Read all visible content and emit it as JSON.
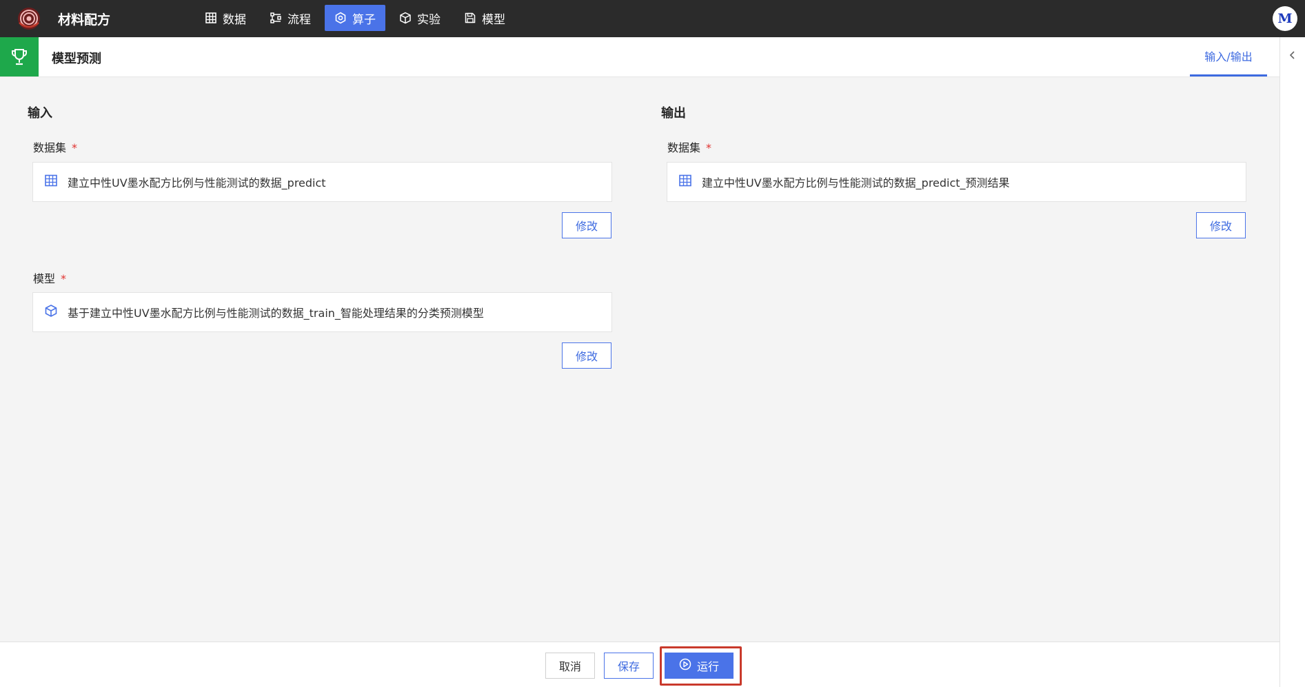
{
  "app": {
    "title": "材料配方",
    "avatar_letter": "M"
  },
  "nav": {
    "items": [
      {
        "label": "数据",
        "icon": "table-grid-icon",
        "active": false
      },
      {
        "label": "流程",
        "icon": "flow-icon",
        "active": false
      },
      {
        "label": "算子",
        "icon": "hexagon-icon",
        "active": true
      },
      {
        "label": "实验",
        "icon": "cube-icon",
        "active": false
      },
      {
        "label": "模型",
        "icon": "floppy-disk-icon",
        "active": false
      }
    ]
  },
  "header": {
    "title": "模型预测",
    "icon": "trophy-icon",
    "tab_label": "输入/输出"
  },
  "input": {
    "section_title": "输入",
    "dataset": {
      "label": "数据集",
      "required": "*",
      "value": "建立中性UV墨水配方比例与性能测试的数据_predict",
      "icon": "table-grid-icon",
      "edit_label": "修改"
    },
    "model": {
      "label": "模型",
      "required": "*",
      "value": "基于建立中性UV墨水配方比例与性能测试的数据_train_智能处理结果的分类预测模型",
      "icon": "cube-icon",
      "edit_label": "修改"
    }
  },
  "output": {
    "section_title": "输出",
    "dataset": {
      "label": "数据集",
      "required": "*",
      "value": "建立中性UV墨水配方比例与性能测试的数据_predict_预测结果",
      "icon": "table-grid-icon",
      "edit_label": "修改"
    }
  },
  "footer": {
    "cancel_label": "取消",
    "save_label": "保存",
    "run_label": "运行"
  },
  "colors": {
    "accent": "#4a73e8",
    "topbar": "#2b2b2b",
    "header_icon_bg": "#1ea84b",
    "required": "#e0322f",
    "highlight_outline": "#c9392b"
  }
}
